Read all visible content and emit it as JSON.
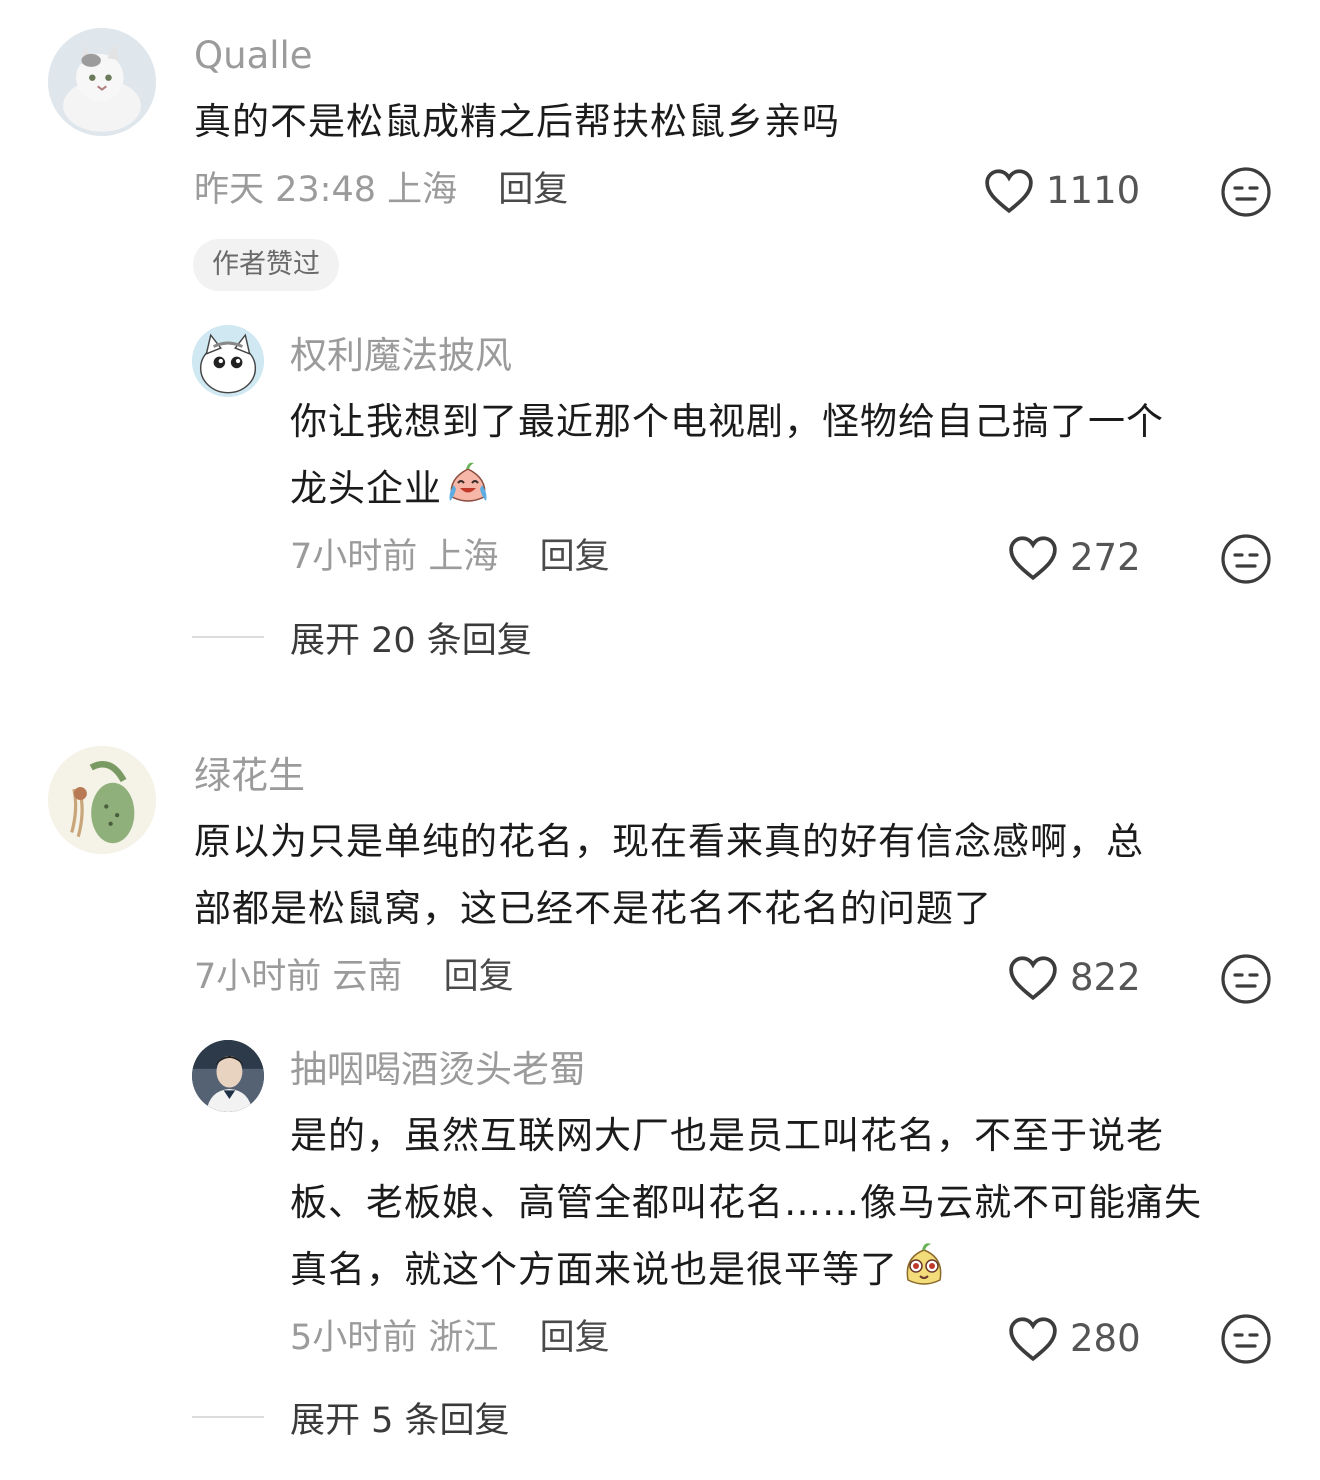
{
  "comments": [
    {
      "username": "Qualle",
      "text": "真的不是松鼠成精之后帮扶松鼠乡亲吗",
      "time": "昨天 23:48",
      "location": "上海",
      "reply_label": "回复",
      "likes": "1110",
      "badge": "作者赞过",
      "replies": [
        {
          "username": "权利魔法披风",
          "text_line1": "你让我想到了最近那个电视剧，怪物给自己搞了一个",
          "text_line2": "龙头企业",
          "emoji": "crying-laugh-emoji",
          "time": "7小时前",
          "location": "上海",
          "reply_label": "回复",
          "likes": "272"
        }
      ],
      "expand_label": "展开 20 条回复"
    },
    {
      "username": "绿花生",
      "text_line1": "原以为只是单纯的花名，现在看来真的好有信念感啊，总",
      "text_line2": "部都是松鼠窝，这已经不是花名不花名的问题了",
      "time": "7小时前",
      "location": "云南",
      "reply_label": "回复",
      "likes": "822",
      "replies": [
        {
          "username": "抽咽喝酒烫头老蜀",
          "text_line1": "是的，虽然互联网大厂也是员工叫花名，不至于说老",
          "text_line2": "板、老板娘、高管全都叫花名……像马云就不可能痛失",
          "text_line3": "真名，就这个方面来说也是很平等了",
          "emoji": "curious-peanut-emoji",
          "time": "5小时前",
          "location": "浙江",
          "reply_label": "回复",
          "likes": "280"
        }
      ],
      "expand_label": "展开 5 条回复"
    }
  ],
  "icons": {
    "like": "heart-outline-icon",
    "dislike": "meh-face-icon"
  },
  "colors": {
    "secondary_text": "#9b9b9b",
    "badge_bg": "#f2f2f2"
  }
}
